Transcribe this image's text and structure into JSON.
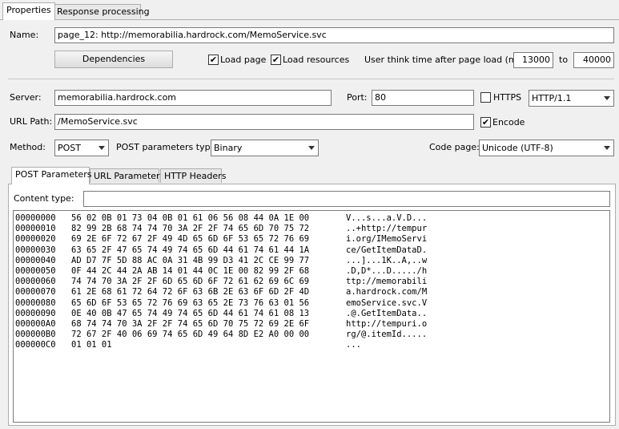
{
  "tabs": {
    "properties": "Properties",
    "response": "Response processing"
  },
  "name": {
    "label": "Name:",
    "value": "page_12: http://memorabilia.hardrock.com/MemoService.svc"
  },
  "dependencies_label": "Dependencies",
  "load_page": {
    "label": "Load page",
    "checked": "✔"
  },
  "load_resources": {
    "label": "Load resources",
    "checked": "✔"
  },
  "think_time": {
    "label": "User think time after page load (ms):",
    "from": "13000",
    "to_label": "to",
    "to": "40000"
  },
  "server": {
    "label": "Server:",
    "value": "memorabilia.hardrock.com"
  },
  "port": {
    "label": "Port:",
    "value": "80"
  },
  "https": {
    "label": "HTTPS",
    "checked": ""
  },
  "http_version": "HTTP/1.1",
  "url_path": {
    "label": "URL Path:",
    "value": "/MemoService.svc"
  },
  "encode": {
    "label": "Encode",
    "checked": "✔"
  },
  "method": {
    "label": "Method:",
    "value": "POST"
  },
  "post_params_type": {
    "label": "POST parameters type:",
    "value": "Binary"
  },
  "code_page": {
    "label": "Code page:",
    "value": "Unicode (UTF-8)"
  },
  "subtabs": {
    "post": "POST Parameters",
    "url": "URL Parameters",
    "headers": "HTTP Headers"
  },
  "content_type": {
    "label": "Content type:",
    "value": ""
  },
  "hex": {
    "offsets": "00000000\n00000010\n00000020\n00000030\n00000040\n00000050\n00000060\n00000070\n00000080\n00000090\n000000A0\n000000B0\n000000C0",
    "bytes": "56 02 0B 01 73 04 0B 01 61 06 56 08 44 0A 1E 00\n82 99 2B 68 74 74 70 3A 2F 2F 74 65 6D 70 75 72\n69 2E 6F 72 67 2F 49 4D 65 6D 6F 53 65 72 76 69\n63 65 2F 47 65 74 49 74 65 6D 44 61 74 61 44 1A\nAD D7 7F 5D 88 AC 0A 31 4B 99 D3 41 2C CE 99 77\n0F 44 2C 44 2A AB 14 01 44 0C 1E 00 82 99 2F 68\n74 74 70 3A 2F 2F 6D 65 6D 6F 72 61 62 69 6C 69\n61 2E 68 61 72 64 72 6F 63 6B 2E 63 6F 6D 2F 4D\n65 6D 6F 53 65 72 76 69 63 65 2E 73 76 63 01 56\n0E 40 0B 47 65 74 49 74 65 6D 44 61 74 61 08 13\n68 74 74 70 3A 2F 2F 74 65 6D 70 75 72 69 2E 6F\n72 67 2F 40 06 69 74 65 6D 49 64 8D E2 A0 00 00\n01 01 01",
    "ascii": "V...s...a.V.D...\n..+http://tempur\ni.org/IMemoServi\nce/GetItemDataD.\n...]...1K..A,..w\n.D,D*...D...../h\nttp://memorabili\na.hardrock.com/M\nemoService.svc.V\n.@.GetItemData..\nhttp://tempuri.o\nrg/@.itemId.....\n..."
  }
}
